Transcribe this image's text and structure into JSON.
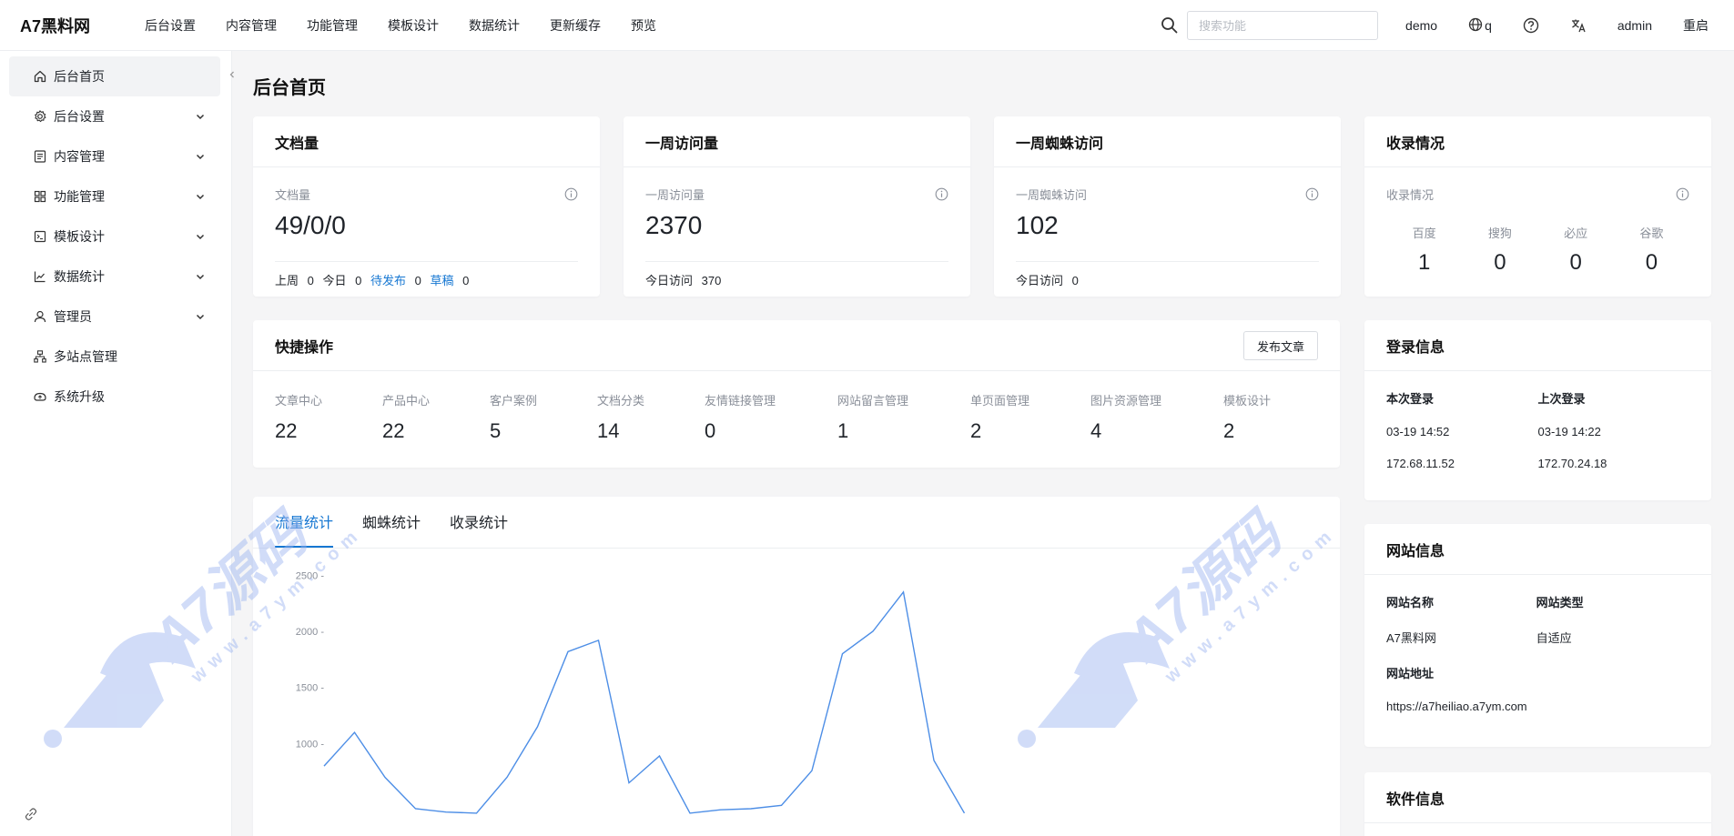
{
  "header": {
    "logo": "A7黑料网",
    "nav": [
      "后台设置",
      "内容管理",
      "功能管理",
      "模板设计",
      "数据统计",
      "更新缓存",
      "预览"
    ],
    "search_placeholder": "搜索功能",
    "user_site": "demo",
    "lang": "q",
    "admin": "admin",
    "restart": "重启"
  },
  "sidebar": {
    "items": [
      {
        "label": "后台首页",
        "icon": "home-icon"
      },
      {
        "label": "后台设置",
        "icon": "gear-icon"
      },
      {
        "label": "内容管理",
        "icon": "document-icon"
      },
      {
        "label": "功能管理",
        "icon": "grid-icon"
      },
      {
        "label": "模板设计",
        "icon": "template-icon"
      },
      {
        "label": "数据统计",
        "icon": "chart-icon"
      },
      {
        "label": "管理员",
        "icon": "user-icon"
      },
      {
        "label": "多站点管理",
        "icon": "network-icon"
      },
      {
        "label": "系统升级",
        "icon": "upgrade-icon"
      }
    ]
  },
  "main": {
    "title": "后台首页",
    "doc_card": {
      "title": "文档量",
      "label": "文档量",
      "value": "49/0/0",
      "foot": {
        "last_week_label": "上周",
        "last_week": "0",
        "today_label": "今日",
        "today": "0",
        "pending_label": "待发布",
        "pending": "0",
        "draft_label": "草稿",
        "draft": "0"
      }
    },
    "visit_card": {
      "title": "一周访问量",
      "label": "一周访问量",
      "value": "2370",
      "foot_label": "今日访问",
      "foot_value": "370"
    },
    "spider_card": {
      "title": "一周蜘蛛访问",
      "label": "一周蜘蛛访问",
      "value": "102",
      "foot_label": "今日访问",
      "foot_value": "0"
    },
    "seo_card": {
      "title": "收录情况",
      "label": "收录情况",
      "engines": [
        {
          "name": "百度",
          "value": "1"
        },
        {
          "name": "搜狗",
          "value": "0"
        },
        {
          "name": "必应",
          "value": "0"
        },
        {
          "name": "谷歌",
          "value": "0"
        }
      ]
    },
    "quick": {
      "title": "快捷操作",
      "button": "发布文章",
      "items": [
        {
          "label": "文章中心",
          "value": "22"
        },
        {
          "label": "产品中心",
          "value": "22"
        },
        {
          "label": "客户案例",
          "value": "5"
        },
        {
          "label": "文档分类",
          "value": "14"
        },
        {
          "label": "友情链接管理",
          "value": "0"
        },
        {
          "label": "网站留言管理",
          "value": "1"
        },
        {
          "label": "单页面管理",
          "value": "2"
        },
        {
          "label": "图片资源管理",
          "value": "4"
        },
        {
          "label": "模板设计",
          "value": "2"
        }
      ]
    },
    "tabs": [
      "流量统计",
      "蜘蛛统计",
      "收录统计"
    ],
    "login": {
      "title": "登录信息",
      "current_label": "本次登录",
      "last_label": "上次登录",
      "current_time": "03-19 14:52",
      "last_time": "03-19 14:22",
      "current_ip": "172.68.11.52",
      "last_ip": "172.70.24.18"
    },
    "site": {
      "title": "网站信息",
      "name_label": "网站名称",
      "type_label": "网站类型",
      "name": "A7黑料网",
      "type": "自适应",
      "url_label": "网站地址",
      "url": "https://a7heiliao.a7ym.com"
    },
    "software": {
      "title": "软件信息"
    },
    "watermark": {
      "brand": "A7源码",
      "domain": "www.a7ym.com"
    }
  },
  "chart_data": {
    "type": "line",
    "ylim": [
      0,
      2600
    ],
    "y_ticks": [
      "2500 -",
      "2000 -",
      "1500 -",
      "1000 -"
    ],
    "y_tick_values": [
      2500,
      2000,
      1500,
      1000
    ],
    "series": [
      {
        "values": [
          800,
          1100,
          700,
          420,
          390,
          380,
          700,
          1150,
          1820,
          1920,
          650,
          890,
          380,
          410,
          420,
          450,
          760,
          1800,
          2000,
          2350,
          850,
          380
        ]
      }
    ],
    "color": "#4d8ee6"
  }
}
